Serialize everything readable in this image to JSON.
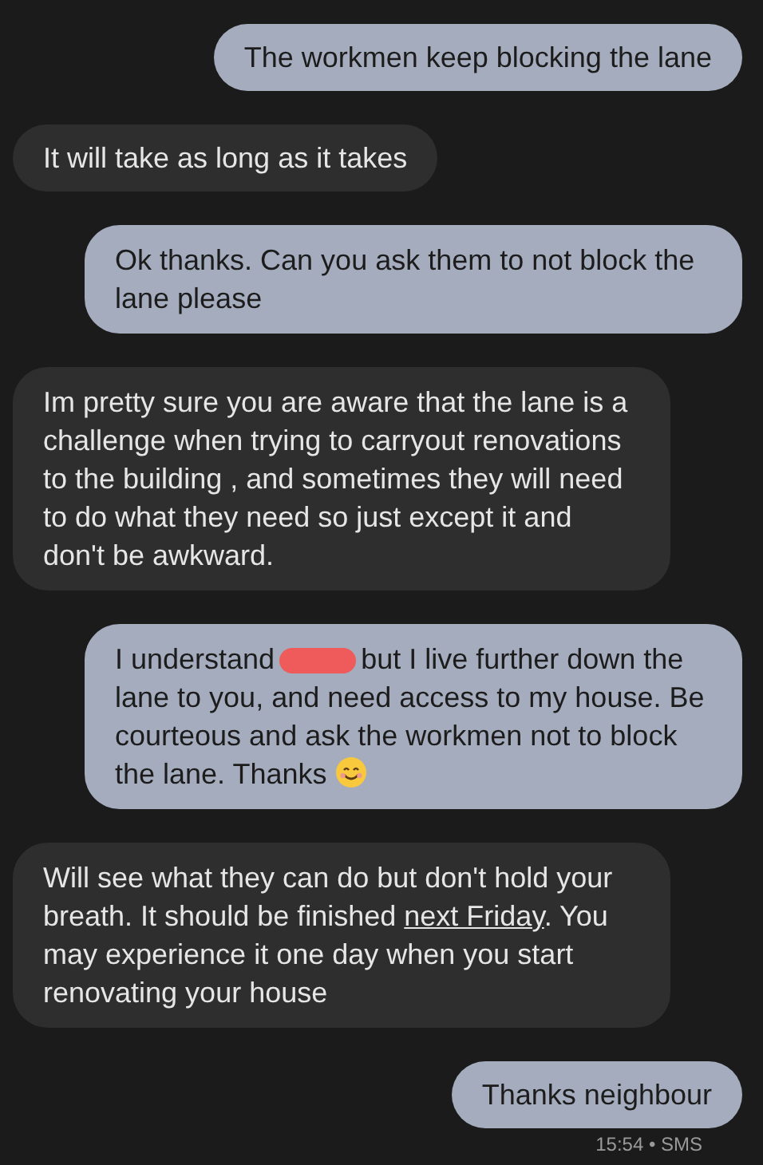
{
  "messages": [
    {
      "outgoing": true,
      "segments": [
        {
          "kind": "text",
          "text": "The workmen keep blocking the lane"
        }
      ]
    },
    {
      "outgoing": false,
      "segments": [
        {
          "kind": "text",
          "text": "It will take as long as it takes"
        }
      ]
    },
    {
      "outgoing": true,
      "segments": [
        {
          "kind": "text",
          "text": "Ok thanks. Can you ask them to not block the lane please"
        }
      ]
    },
    {
      "outgoing": false,
      "segments": [
        {
          "kind": "text",
          "text": "Im pretty sure you are aware that the lane is a challenge when trying to carryout renovations to the building , and sometimes they will need to do what they need  so just except it and don't be awkward."
        }
      ]
    },
    {
      "outgoing": true,
      "segments": [
        {
          "kind": "text",
          "text": "I understand"
        },
        {
          "kind": "redaction",
          "color": "#ef5b5b"
        },
        {
          "kind": "text",
          "text": "but I live further down the lane to you, and need access to my house. Be courteous and ask the workmen not to block the lane. Thanks "
        },
        {
          "kind": "emoji"
        }
      ]
    },
    {
      "outgoing": false,
      "segments": [
        {
          "kind": "text",
          "text": "Will see what they can do but don't hold your breath. It should be finished "
        },
        {
          "kind": "link",
          "text": "next Friday"
        },
        {
          "kind": "text",
          "text": ". You may experience it one day when you start renovating your house"
        }
      ]
    },
    {
      "outgoing": true,
      "segments": [
        {
          "kind": "text",
          "text": "Thanks neighbour"
        }
      ]
    }
  ],
  "footer": {
    "status": "15:54 • SMS"
  }
}
